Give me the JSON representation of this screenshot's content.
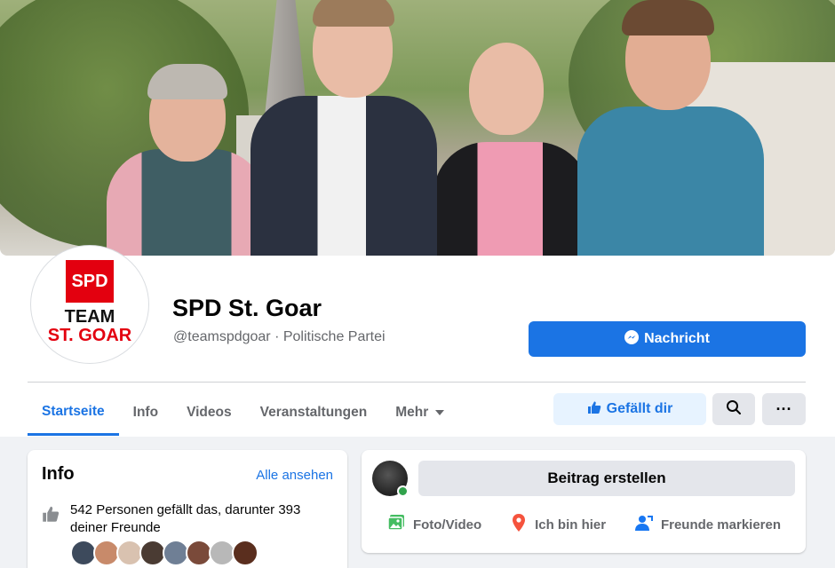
{
  "page": {
    "name": "SPD St. Goar",
    "handle": "@teamspdgoar",
    "separator": " · ",
    "category": "Politische Partei"
  },
  "avatar": {
    "logo_text": "SPD",
    "line1": "TEAM",
    "line2": "ST. GOAR"
  },
  "actions": {
    "message_label": "Nachricht",
    "like_label": "Gefällt dir",
    "search_icon": "search-icon",
    "more_icon": "more-icon",
    "more_glyph": "···"
  },
  "tabs": [
    {
      "label": "Startseite",
      "active": true
    },
    {
      "label": "Info"
    },
    {
      "label": "Videos"
    },
    {
      "label": "Veranstaltungen"
    },
    {
      "label": "Mehr"
    }
  ],
  "info_card": {
    "title": "Info",
    "see_all": "Alle ansehen",
    "likes_text": "542 Personen gefällt das, darunter 393 deiner Freunde"
  },
  "composer": {
    "create_post": "Beitrag erstellen",
    "photo_video": "Foto/Video",
    "check_in": "Ich bin hier",
    "tag_friends": "Freunde markieren"
  },
  "colors": {
    "accent": "#1b74e4",
    "brand_red": "#e3000f",
    "online": "#31a24c"
  }
}
